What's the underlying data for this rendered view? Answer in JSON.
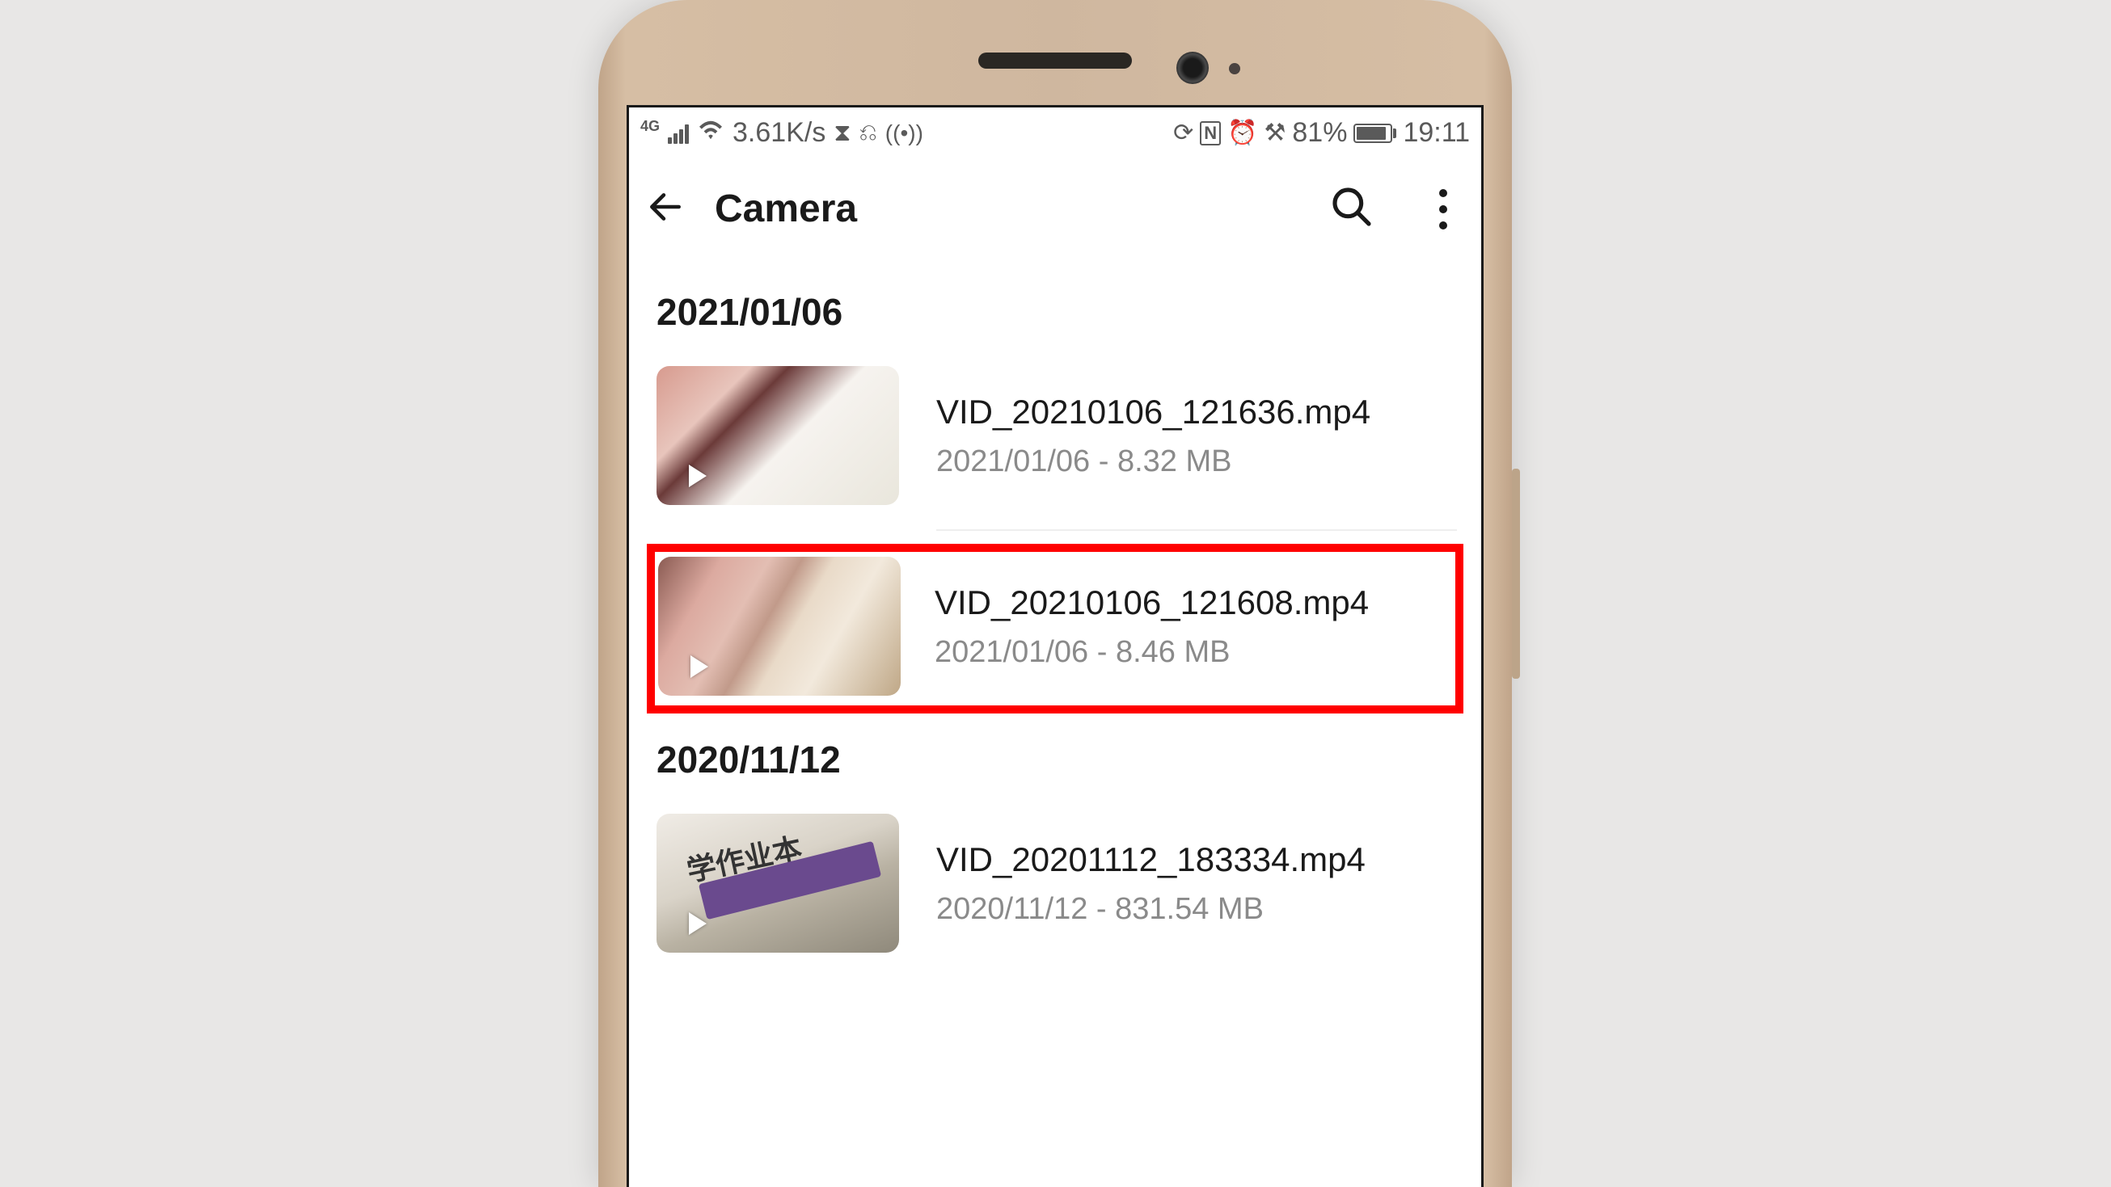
{
  "status": {
    "network_type": "4G",
    "speed": "3.61K/s",
    "battery_pct": "81%",
    "time": "19:11"
  },
  "header": {
    "title": "Camera"
  },
  "groups": [
    {
      "date": "2021/01/06",
      "files": [
        {
          "name": "VID_20210106_121636.mp4",
          "meta": "2021/01/06 - 8.32 MB",
          "highlighted": false
        },
        {
          "name": "VID_20210106_121608.mp4",
          "meta": "2021/01/06 - 8.46 MB",
          "highlighted": true
        }
      ]
    },
    {
      "date": "2020/11/12",
      "files": [
        {
          "name": "VID_20201112_183334.mp4",
          "meta": "2020/11/12 - 831.54 MB",
          "highlighted": false
        }
      ]
    }
  ]
}
